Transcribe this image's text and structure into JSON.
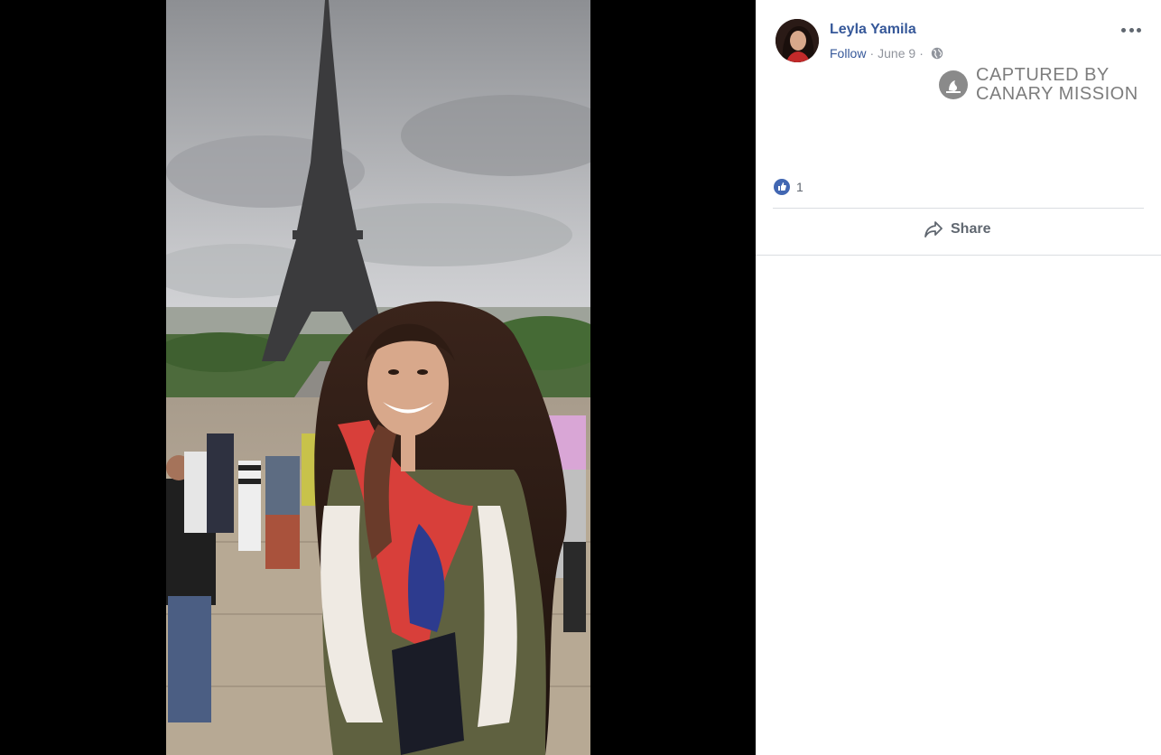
{
  "post": {
    "author": "Leyla Yamila",
    "follow_label": "Follow",
    "separator": "·",
    "date": "June 9",
    "audience_icon": "globe-icon",
    "like_count": "1",
    "share_label": "Share"
  },
  "watermark": {
    "line1": "CAPTURED BY",
    "line2": "CANARY MISSION"
  },
  "colors": {
    "link": "#365899",
    "meta": "#90949c",
    "like_badge": "#4267b2",
    "divider": "#dadde1"
  }
}
